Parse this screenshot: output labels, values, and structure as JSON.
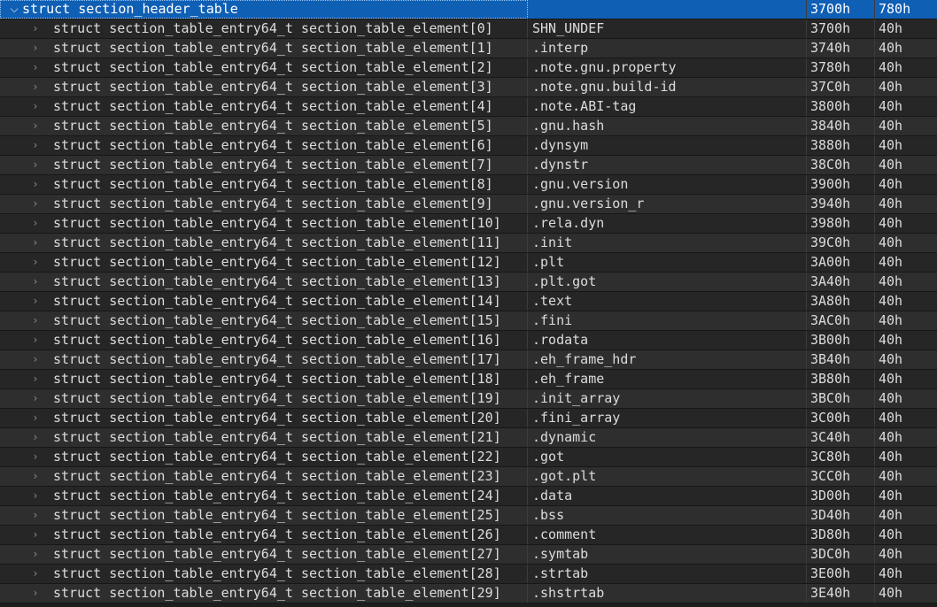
{
  "header": {
    "label": "struct section_header_table",
    "value": "",
    "start": "3700h",
    "size": "780h"
  },
  "rows": [
    {
      "label": "struct section_table_entry64_t section_table_element[0]",
      "value": "SHN_UNDEF",
      "start": "3700h",
      "size": "40h"
    },
    {
      "label": "struct section_table_entry64_t section_table_element[1]",
      "value": ".interp",
      "start": "3740h",
      "size": "40h"
    },
    {
      "label": "struct section_table_entry64_t section_table_element[2]",
      "value": ".note.gnu.property",
      "start": "3780h",
      "size": "40h"
    },
    {
      "label": "struct section_table_entry64_t section_table_element[3]",
      "value": ".note.gnu.build-id",
      "start": "37C0h",
      "size": "40h"
    },
    {
      "label": "struct section_table_entry64_t section_table_element[4]",
      "value": ".note.ABI-tag",
      "start": "3800h",
      "size": "40h"
    },
    {
      "label": "struct section_table_entry64_t section_table_element[5]",
      "value": ".gnu.hash",
      "start": "3840h",
      "size": "40h"
    },
    {
      "label": "struct section_table_entry64_t section_table_element[6]",
      "value": ".dynsym",
      "start": "3880h",
      "size": "40h"
    },
    {
      "label": "struct section_table_entry64_t section_table_element[7]",
      "value": ".dynstr",
      "start": "38C0h",
      "size": "40h"
    },
    {
      "label": "struct section_table_entry64_t section_table_element[8]",
      "value": ".gnu.version",
      "start": "3900h",
      "size": "40h"
    },
    {
      "label": "struct section_table_entry64_t section_table_element[9]",
      "value": ".gnu.version_r",
      "start": "3940h",
      "size": "40h"
    },
    {
      "label": "struct section_table_entry64_t section_table_element[10]",
      "value": ".rela.dyn",
      "start": "3980h",
      "size": "40h"
    },
    {
      "label": "struct section_table_entry64_t section_table_element[11]",
      "value": ".init",
      "start": "39C0h",
      "size": "40h"
    },
    {
      "label": "struct section_table_entry64_t section_table_element[12]",
      "value": ".plt",
      "start": "3A00h",
      "size": "40h"
    },
    {
      "label": "struct section_table_entry64_t section_table_element[13]",
      "value": ".plt.got",
      "start": "3A40h",
      "size": "40h"
    },
    {
      "label": "struct section_table_entry64_t section_table_element[14]",
      "value": ".text",
      "start": "3A80h",
      "size": "40h"
    },
    {
      "label": "struct section_table_entry64_t section_table_element[15]",
      "value": ".fini",
      "start": "3AC0h",
      "size": "40h"
    },
    {
      "label": "struct section_table_entry64_t section_table_element[16]",
      "value": ".rodata",
      "start": "3B00h",
      "size": "40h"
    },
    {
      "label": "struct section_table_entry64_t section_table_element[17]",
      "value": ".eh_frame_hdr",
      "start": "3B40h",
      "size": "40h"
    },
    {
      "label": "struct section_table_entry64_t section_table_element[18]",
      "value": ".eh_frame",
      "start": "3B80h",
      "size": "40h"
    },
    {
      "label": "struct section_table_entry64_t section_table_element[19]",
      "value": ".init_array",
      "start": "3BC0h",
      "size": "40h"
    },
    {
      "label": "struct section_table_entry64_t section_table_element[20]",
      "value": ".fini_array",
      "start": "3C00h",
      "size": "40h"
    },
    {
      "label": "struct section_table_entry64_t section_table_element[21]",
      "value": ".dynamic",
      "start": "3C40h",
      "size": "40h"
    },
    {
      "label": "struct section_table_entry64_t section_table_element[22]",
      "value": ".got",
      "start": "3C80h",
      "size": "40h"
    },
    {
      "label": "struct section_table_entry64_t section_table_element[23]",
      "value": ".got.plt",
      "start": "3CC0h",
      "size": "40h"
    },
    {
      "label": "struct section_table_entry64_t section_table_element[24]",
      "value": ".data",
      "start": "3D00h",
      "size": "40h"
    },
    {
      "label": "struct section_table_entry64_t section_table_element[25]",
      "value": ".bss",
      "start": "3D40h",
      "size": "40h"
    },
    {
      "label": "struct section_table_entry64_t section_table_element[26]",
      "value": ".comment",
      "start": "3D80h",
      "size": "40h"
    },
    {
      "label": "struct section_table_entry64_t section_table_element[27]",
      "value": ".symtab",
      "start": "3DC0h",
      "size": "40h"
    },
    {
      "label": "struct section_table_entry64_t section_table_element[28]",
      "value": ".strtab",
      "start": "3E00h",
      "size": "40h"
    },
    {
      "label": "struct section_table_entry64_t section_table_element[29]",
      "value": ".shstrtab",
      "start": "3E40h",
      "size": "40h"
    }
  ],
  "icons": {
    "expanded": "chevron-down-icon",
    "collapsed": "chevron-right-icon"
  },
  "colors": {
    "selection": "#0f5fb5",
    "background": "#1e1e1e",
    "text": "#dcdcdc"
  }
}
